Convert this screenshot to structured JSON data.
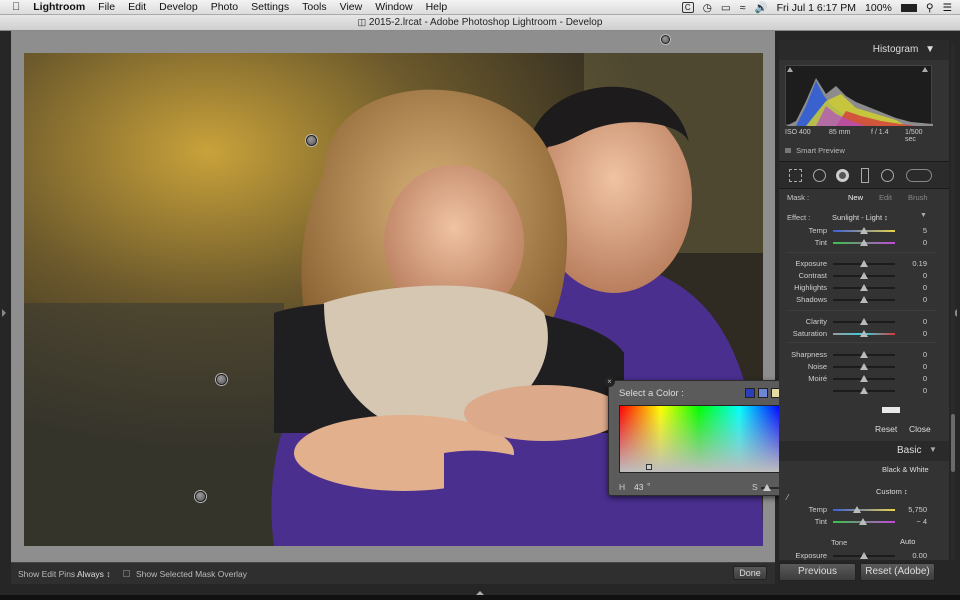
{
  "menubar": {
    "app": "Lightroom",
    "items": [
      "File",
      "Edit",
      "Develop",
      "Photo",
      "Settings",
      "Tools",
      "View",
      "Window",
      "Help"
    ],
    "status_time": "Fri Jul 1  6:17 PM",
    "battery": "100%"
  },
  "window": {
    "title": "2015-2.lrcat - Adobe Photoshop Lightroom - Develop"
  },
  "histogram": {
    "label": "Histogram",
    "iso": "ISO 400",
    "focal": "85 mm",
    "aperture": "f / 1.4",
    "shutter": "1/500 sec",
    "smart_preview": "Smart Preview"
  },
  "mask": {
    "label": "Mask :",
    "new": "New",
    "edit": "Edit",
    "brush": "Brush"
  },
  "effect": {
    "label": "Effect :",
    "preset": "Sunlight - Light  ↕"
  },
  "sliders": [
    {
      "label": "Temp",
      "value": "5"
    },
    {
      "label": "Tint",
      "value": "0"
    },
    {
      "label": "Exposure",
      "value": "0.19"
    },
    {
      "label": "Contrast",
      "value": "0"
    },
    {
      "label": "Highlights",
      "value": "0"
    },
    {
      "label": "Shadows",
      "value": "0"
    },
    {
      "label": "Clarity",
      "value": "0"
    },
    {
      "label": "Saturation",
      "value": "0"
    },
    {
      "label": "Sharpness",
      "value": "0"
    },
    {
      "label": "Noise",
      "value": "0"
    },
    {
      "label": "Moiré",
      "value": "0"
    },
    {
      "label": "",
      "value": "0"
    }
  ],
  "color_picker": {
    "title": "Select a Color :",
    "h_label": "H",
    "h_value": "43",
    "h_unit": "°",
    "s_label": "S",
    "s_value": "5",
    "s_unit": "%",
    "swatches": [
      "#2a3fb3",
      "#6f86d6",
      "#e6d9a4",
      "#e3c84e",
      "#d6ad14"
    ],
    "current_color": "#dcd9d2"
  },
  "panel_buttons": {
    "reset": "Reset",
    "close": "Close"
  },
  "basic": {
    "label": "Basic",
    "bw": "Black & White",
    "wb_value": "Custom  ↕",
    "temp_label": "Temp",
    "temp_value": "5,750",
    "tint_label": "Tint",
    "tint_value": "− 4",
    "tone_label": "Tone",
    "auto": "Auto",
    "exposure_label": "Exposure",
    "exposure_value": "0.00"
  },
  "bottom": {
    "show_pins_label": "Show Edit Pins :",
    "show_pins_value": "Always  ↕",
    "overlay_label": "Show Selected Mask Overlay",
    "done": "Done",
    "previous": "Previous",
    "reset_adobe": "Reset (Adobe)"
  }
}
